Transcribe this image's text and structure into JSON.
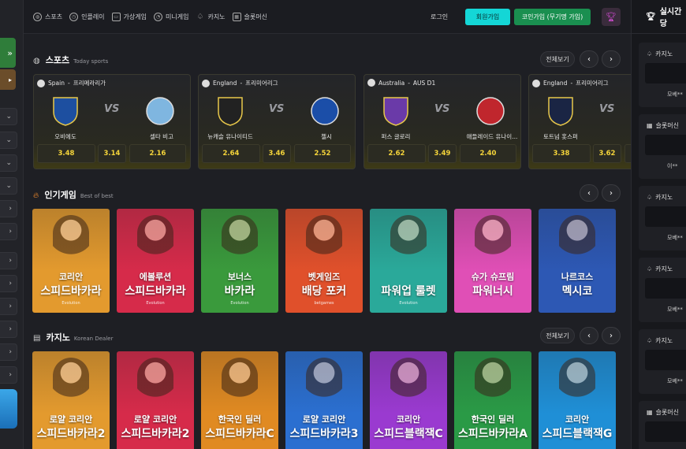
{
  "header": {
    "nav": [
      {
        "label": "스포츠",
        "icon": "globe-icon"
      },
      {
        "label": "인플레이",
        "icon": "stopwatch-icon"
      },
      {
        "label": "가상게임",
        "icon": "monitor-icon"
      },
      {
        "label": "미니게임",
        "icon": "pie-icon"
      },
      {
        "label": "카지노",
        "icon": "spade-icon"
      },
      {
        "label": "슬롯머신",
        "icon": "slot-icon"
      }
    ],
    "login": "로그인",
    "signup": "회원가입",
    "coin_signup": "코인가입 (무기명 가입)"
  },
  "right_panel": {
    "title": "실시간당",
    "cards": [
      {
        "type": "카지노",
        "user": "모베**"
      },
      {
        "type": "슬롯머신",
        "user": "이**"
      },
      {
        "type": "카지노",
        "user": "모베**"
      },
      {
        "type": "카지노",
        "user": "모베**"
      },
      {
        "type": "카지노",
        "user": "모베**"
      },
      {
        "type": "슬롯머신",
        "user": ""
      }
    ]
  },
  "sports": {
    "title": "스포츠",
    "subtitle": "Today sports",
    "view_all": "전체보기",
    "matches": [
      {
        "country": "Spain",
        "league": "프리메라리가",
        "home": "오비에도",
        "away": "셀타 비고",
        "odds": [
          "3.48",
          "3.14",
          "2.16"
        ],
        "home_color": "#1d4fa0",
        "away_color": "#7fb6e0"
      },
      {
        "country": "England",
        "league": "프리미어리그",
        "home": "뉴캐슬 유나이티드",
        "away": "첼시",
        "odds": [
          "2.64",
          "3.46",
          "2.52"
        ],
        "home_color": "#222222",
        "away_color": "#1b4ea8"
      },
      {
        "country": "Australia",
        "league": "AUS D1",
        "home": "퍼스 글로리",
        "away": "애들레이드 유나이...",
        "odds": [
          "2.62",
          "3.49",
          "2.40"
        ],
        "home_color": "#6a3aa8",
        "away_color": "#c0262d"
      },
      {
        "country": "England",
        "league": "프리미어리그",
        "home": "토트넘 홋스퍼",
        "away": "",
        "odds": [
          "3.38",
          "3.62",
          ""
        ],
        "home_color": "#1a2544",
        "away_color": "#444444"
      }
    ],
    "vs": "VS"
  },
  "popular": {
    "title": "인기게임",
    "subtitle": "Best of best",
    "tiles": [
      {
        "l1": "코리안",
        "l2": "스피드바카라",
        "provider": "Evolution",
        "color": "#e39a2e"
      },
      {
        "l1": "에볼루션",
        "l2": "스피드바카라",
        "provider": "Evolution",
        "color": "#d62b4a"
      },
      {
        "l1": "보너스",
        "l2": "바카라",
        "provider": "Evolution",
        "color": "#3a9a3c"
      },
      {
        "l1": "벳게임즈",
        "l2": "배당 포커",
        "provider": "betgames",
        "color": "#e0502b"
      },
      {
        "l1": "",
        "l2": "파워업 룰렛",
        "provider": "Evolution",
        "color": "#2aa99a"
      },
      {
        "l1": "슈가 슈프림",
        "l2": "파워너시",
        "provider": "",
        "color": "#e04fb6"
      },
      {
        "l1": "나르코스",
        "l2": "멕시코",
        "provider": "",
        "color": "#2d58b4"
      }
    ]
  },
  "casino": {
    "title": "카지노",
    "subtitle": "Korean Dealer",
    "view_all": "전체보기",
    "tiles": [
      {
        "l1": "로얄 코리안",
        "l2": "스피드바카라2",
        "color": "#e39a2e"
      },
      {
        "l1": "로얄 코리안",
        "l2": "스피드바카라2",
        "color": "#d62b4a"
      },
      {
        "l1": "한국인 딜러",
        "l2": "스피드바카라C",
        "color": "#e08a22"
      },
      {
        "l1": "로얄 코리안",
        "l2": "스피드바카라3",
        "color": "#2b6fd0"
      },
      {
        "l1": "코리안",
        "l2": "스피드블랙잭C",
        "color": "#9a3ad0"
      },
      {
        "l1": "한국인 딜러",
        "l2": "스피드바카라A",
        "color": "#2a9a46"
      },
      {
        "l1": "코리안",
        "l2": "스피드블랙잭G",
        "color": "#1f8fd6"
      }
    ]
  }
}
